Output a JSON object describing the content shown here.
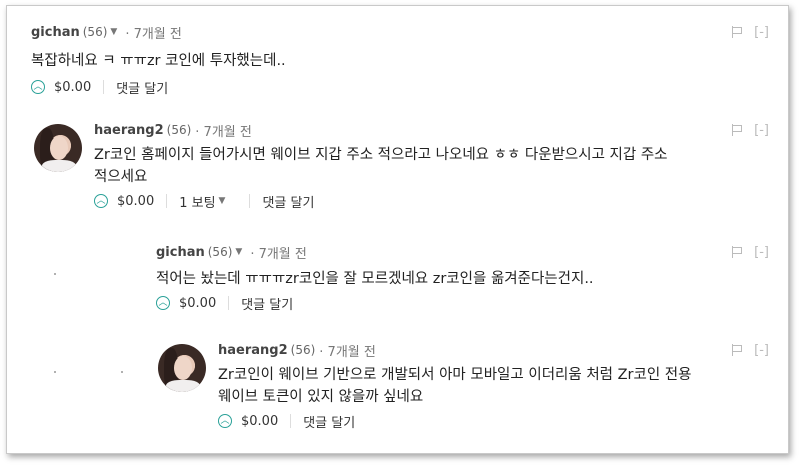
{
  "comments": [
    {
      "author": "gichan",
      "rep": "(56)",
      "time": "· 7개월 전",
      "body": [
        "복잡하네요 ㅋ ㅠㅠzr 코인에 투자했는데.."
      ],
      "payout": "$0.00",
      "votes": "",
      "reply": "댓글 달기",
      "flag": "flag-icon",
      "collapse": "[-]"
    },
    {
      "author": "haerang2",
      "rep": "(56)",
      "time": "· 7개월 전",
      "body": [
        "Zr코인 홈페이지 들어가시면 웨이브 지갑 주소 적으라고 나오네요 ㅎㅎ 다운받으시고 지갑 주소",
        "적으세요"
      ],
      "payout": "$0.00",
      "votes": "1 보팅",
      "reply": "댓글 달기",
      "collapse": "[-]"
    },
    {
      "author": "gichan",
      "rep": "(56)",
      "time": "· 7개월 전",
      "body": [
        "적어는 놨는데 ㅠㅠㅠzr코인을 잘 모르겠네요 zr코인을 옮겨준다는건지.."
      ],
      "payout": "$0.00",
      "votes": "",
      "reply": "댓글 달기",
      "collapse": "[-]"
    },
    {
      "author": "haerang2",
      "rep": "(56)",
      "time": "· 7개월 전",
      "body": [
        "Zr코인이 웨이브 기반으로 개발되서 아마 모바일고 이더리움 처럼 Zr코인 전용",
        "웨이브 토큰이 있지 않을까 싶네요"
      ],
      "payout": "$0.00",
      "votes": "",
      "reply": "댓글 달기",
      "collapse": "[-]"
    }
  ],
  "colors": {
    "accent": "#2aa198",
    "text": "#222222",
    "muted": "#777777"
  },
  "icons": {
    "upvote": "chevron-up-icon",
    "dropdown": "caret-down-icon",
    "flag": "flag-icon"
  }
}
